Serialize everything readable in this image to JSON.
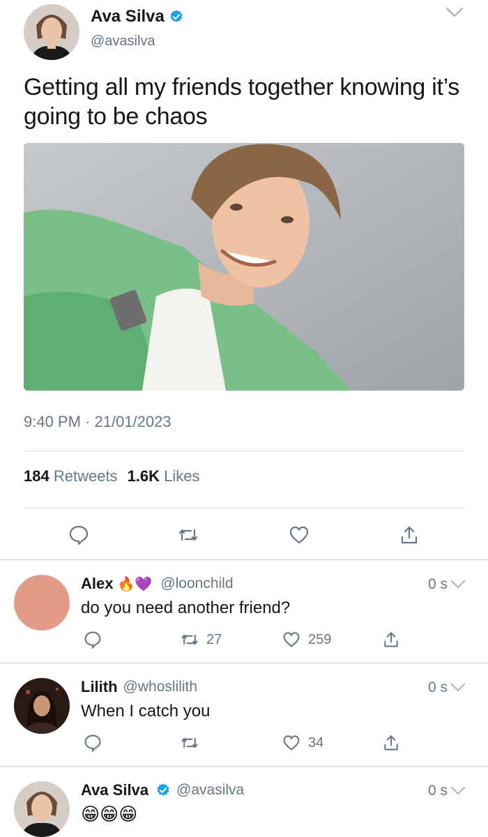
{
  "tweet": {
    "author_name": "Ava Silva",
    "author_handle": "@avasilva",
    "text": "Getting all my friends together knowing it’s going to be chaos",
    "timestamp": "9:40 PM · 21/01/2023",
    "retweet_count": "184",
    "retweet_label": "Retweets",
    "like_count": "1.6K",
    "like_label": "Likes"
  },
  "replies": [
    {
      "name": "Alex",
      "emojis": "🔥💜",
      "handle": "@loonchild",
      "time": "0 s",
      "text": "do you need another friend?",
      "retweets": "27",
      "likes": "259"
    },
    {
      "name": "Lilith",
      "handle": "@whoslilith",
      "time": "0 s",
      "text": "When I catch you",
      "retweets": "",
      "likes": "34"
    },
    {
      "name": "Ava Silva",
      "handle": "@avasilva",
      "time": "0 s",
      "text": "😁😁😁"
    }
  ],
  "colors": {
    "accent": "#1da1f2",
    "muted": "#657786",
    "text": "#14171a",
    "avatar_alex": "#e39a86"
  },
  "icons": {
    "verified": "verified-badge-icon",
    "caret": "chevron-down-icon",
    "reply": "reply-icon",
    "retweet": "retweet-icon",
    "like": "heart-icon",
    "share": "share-icon"
  }
}
